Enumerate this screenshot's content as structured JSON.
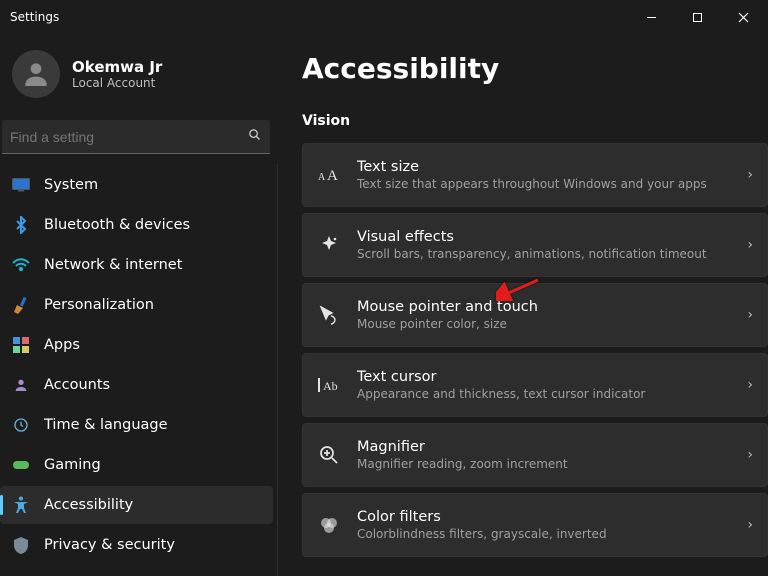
{
  "window": {
    "title": "Settings"
  },
  "user": {
    "name": "Okemwa Jr",
    "role": "Local Account"
  },
  "search": {
    "placeholder": "Find a setting"
  },
  "nav": {
    "system": "System",
    "bluetooth": "Bluetooth & devices",
    "network": "Network & internet",
    "personalization": "Personalization",
    "apps": "Apps",
    "accounts": "Accounts",
    "time": "Time & language",
    "gaming": "Gaming",
    "accessibility": "Accessibility",
    "privacy": "Privacy & security"
  },
  "page": {
    "heading": "Accessibility",
    "section1": "Vision",
    "cards": {
      "textsize": {
        "title": "Text size",
        "sub": "Text size that appears throughout Windows and your apps"
      },
      "visual": {
        "title": "Visual effects",
        "sub": "Scroll bars, transparency, animations, notification timeout"
      },
      "pointer": {
        "title": "Mouse pointer and touch",
        "sub": "Mouse pointer color, size"
      },
      "cursor": {
        "title": "Text cursor",
        "sub": "Appearance and thickness, text cursor indicator"
      },
      "magnifier": {
        "title": "Magnifier",
        "sub": "Magnifier reading, zoom increment"
      },
      "colorfilt": {
        "title": "Color filters",
        "sub": "Colorblindness filters, grayscale, inverted"
      }
    }
  }
}
